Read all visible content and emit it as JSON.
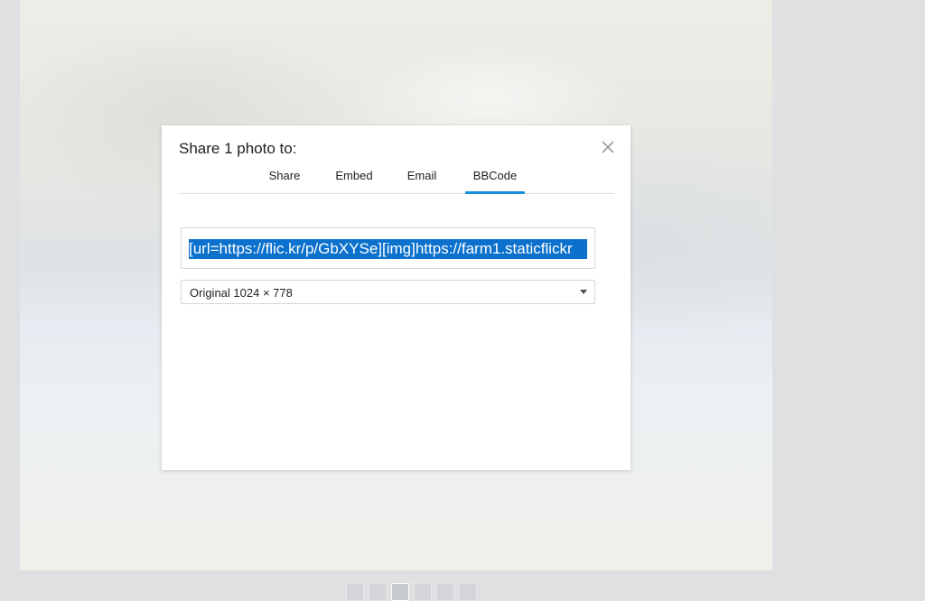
{
  "modal": {
    "title": "Share 1 photo to:",
    "tabs": [
      {
        "label": "Share"
      },
      {
        "label": "Embed"
      },
      {
        "label": "Email"
      },
      {
        "label": "BBCode",
        "active": true
      }
    ],
    "code_value": "[url=https://flic.kr/p/GbXYSe][img]https://farm1.staticflickr",
    "size_select": {
      "selected": "Original 1024 × 778"
    }
  },
  "colors": {
    "accent": "#128fdc",
    "selection": "#0b71cc",
    "backdrop": "#dfe0e1"
  },
  "icons": {
    "close": "close-icon",
    "dropdown": "chevron-down-icon"
  }
}
